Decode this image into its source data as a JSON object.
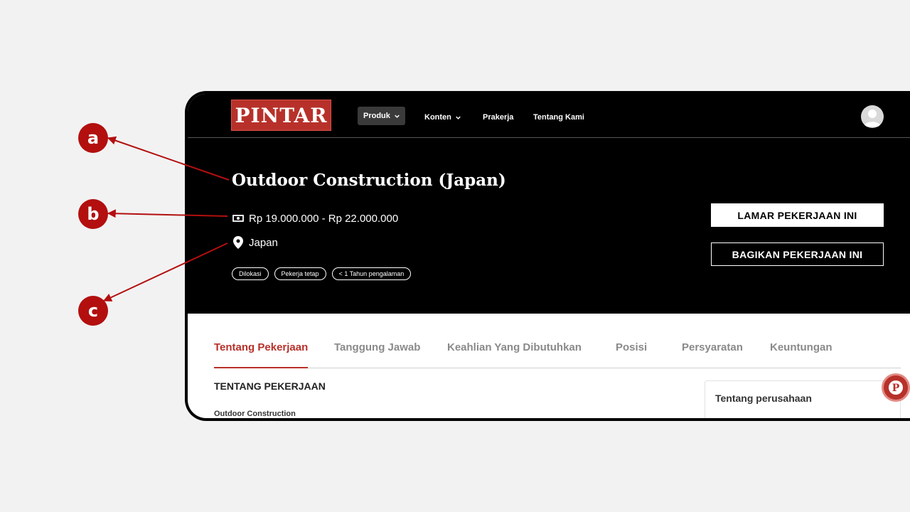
{
  "nav": {
    "logo": "PINTAR",
    "items": [
      {
        "label": "Produk",
        "has_dropdown": true,
        "active": true
      },
      {
        "label": "Konten",
        "has_dropdown": true,
        "active": false
      },
      {
        "label": "Prakerja",
        "has_dropdown": false,
        "active": false
      },
      {
        "label": "Tentang Kami",
        "has_dropdown": false,
        "active": false
      }
    ],
    "avatar_icon": "user-avatar-icon"
  },
  "job": {
    "title": "Outdoor Construction (Japan)",
    "salary": "Rp 19.000.000 - Rp 22.000.000",
    "location": "Japan",
    "tags": [
      "Dilokasi",
      "Pekerja tetap",
      "< 1 Tahun pengalaman"
    ],
    "apply_label": "LAMAR PEKERJAAN INI",
    "share_label": "BAGIKAN PEKERJAAN INI"
  },
  "tabs": [
    {
      "label": "Tentang Pekerjaan",
      "active": true
    },
    {
      "label": "Tanggung Jawab",
      "active": false
    },
    {
      "label": "Keahlian Yang Dibutuhkan",
      "active": false
    },
    {
      "label": "Posisi",
      "active": false
    },
    {
      "label": "Persyaratan",
      "active": false
    },
    {
      "label": "Keuntungan",
      "active": false
    }
  ],
  "content": {
    "section_title": "TENTANG PEKERJAAN",
    "section_sub": "Outdoor Construction",
    "company_card_title": "Tentang perusahaan"
  },
  "annotations": {
    "markers": [
      "a",
      "b",
      "c"
    ]
  },
  "colors": {
    "brand": "#b7312a",
    "marker": "#b30f0f",
    "hero_bg": "#000000"
  }
}
